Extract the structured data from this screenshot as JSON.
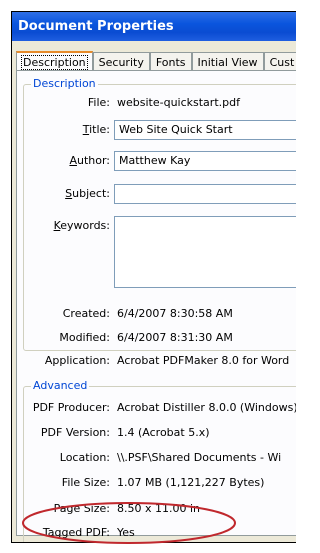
{
  "window": {
    "title": "Document Properties"
  },
  "tabs": [
    {
      "label": "Description",
      "active": true
    },
    {
      "label": "Security"
    },
    {
      "label": "Fonts"
    },
    {
      "label": "Initial View"
    },
    {
      "label": "Cust"
    }
  ],
  "description": {
    "legend": "Description",
    "file_label": "File:",
    "file_value": "website-quickstart.pdf",
    "title_label_ul": "T",
    "title_label_rest": "itle:",
    "title_value": "Web Site Quick Start",
    "author_label_ul": "A",
    "author_label_rest": "uthor:",
    "author_value": "Matthew Kay",
    "subject_label_ul": "S",
    "subject_label_rest": "ubject:",
    "subject_value": "",
    "keywords_label_ul": "K",
    "keywords_label_rest": "eywords:",
    "keywords_value": "",
    "created_label": "Created:",
    "created_value": "6/4/2007 8:30:58 AM",
    "modified_label": "Modified:",
    "modified_value": "6/4/2007 8:31:30 AM",
    "application_label": "Application:",
    "application_value": "Acrobat PDFMaker 8.0 for Word"
  },
  "advanced": {
    "legend": "Advanced",
    "producer_label": "PDF Producer:",
    "producer_value": "Acrobat Distiller 8.0.0 (Windows)",
    "version_label": "PDF Version:",
    "version_value": "1.4 (Acrobat 5.x)",
    "location_label": "Location:",
    "location_value": "\\\\.PSF\\Shared Documents - Wi",
    "filesize_label": "File Size:",
    "filesize_value": "1.07 MB (1,121,227 Bytes)",
    "pagesize_label": "Page Size:",
    "pagesize_value": "8.50 x 11.00 in",
    "tagged_label": "Tagged PDF:",
    "tagged_value": "Yes"
  },
  "colors": {
    "annotation_circle": "#c0282d",
    "title_bar": "#0a55de",
    "legend_text": "#0046d5"
  }
}
